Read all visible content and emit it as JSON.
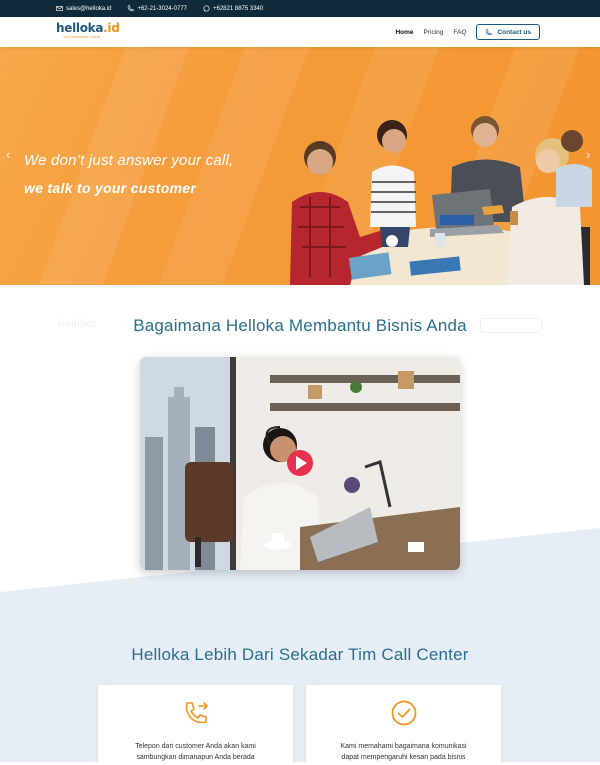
{
  "topbar": {
    "email": "sales@helloka.id",
    "phone": "+62-21-3024-0777",
    "whatsapp": "+62821 8875 3340"
  },
  "navbar": {
    "logo_main": "helloka",
    "logo_accent": ".id",
    "logo_tagline": "Your Impression Counts",
    "menu": [
      "Home",
      "Pricing",
      "FAQ"
    ],
    "contact_label": "Contact us"
  },
  "hero": {
    "line1": "We don’t just answer your call,",
    "line2": "we talk to your customer",
    "prev_arrow": "‹",
    "next_arrow": "›"
  },
  "section_help": {
    "title": "Bagaimana Helloka Membantu Bisnis Anda"
  },
  "section_more": {
    "title": "Helloka Lebih Dari Sekadar Tim Call Center",
    "cards": [
      {
        "icon": "phone-forward-icon",
        "text_line1": "Telepon dari customer Anda akan kami",
        "text_line2": "sambungkan dimanapun Anda berada"
      },
      {
        "icon": "check-circle-icon",
        "text_line1": "Kami memahami bagaimana komunikasi",
        "text_line2": "dapat mempengaruhi kesan pada bisnis"
      }
    ]
  },
  "colors": {
    "topbar_bg": "#0f2a3c",
    "brand_blue": "#1d5a86",
    "brand_orange": "#f39523",
    "heading_teal": "#2a6f8f",
    "section_bg": "#e7edf5",
    "play_red": "#e8304f"
  }
}
